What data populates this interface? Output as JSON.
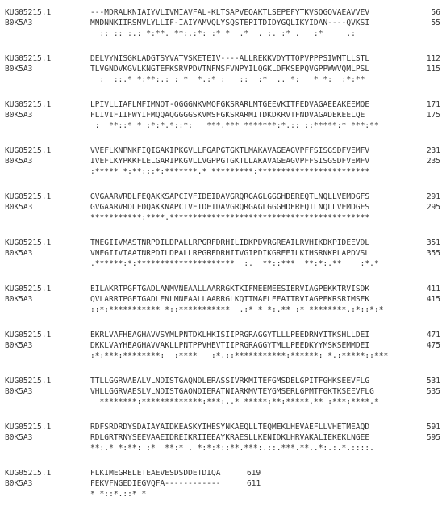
{
  "alignment": {
    "blocks": [
      {
        "rows": [
          {
            "name": "KUG05215.1",
            "seq": "---MDRALKNIAIYVLIVMIAVFAL-KLTSAPVEQAKTLSEPEFYTKVSQGQVAEAVVEV",
            "pos": "56"
          },
          {
            "name": "B0K5A3",
            "seq": "MNDNNKIIRSMVLYLLIF-IAIYAMVQLYSQSTEPITDIDYGQLIKYIDAN----QVKSI",
            "pos": "55"
          }
        ],
        "cons": "  :: :: :.: *:**. **:.:*: :* *  .*  . :. :* .   :*     .:  "
      },
      {
        "rows": [
          {
            "name": "KUG05215.1",
            "seq": "DELVYNISGKLADGTSYVATVSKETEIV----ALLREKKVDYTTQPVPPPSIWMTLLSTL",
            "pos": "112"
          },
          {
            "name": "B0K5A3",
            "seq": "TLVGNDVKGVLKNGTEFKSRVPDVTNFMSFVNPYILQGKLDFKSEPQVGPPWWVQMLPSL",
            "pos": "115"
          }
        ],
        "cons": "  :  ::.* *:**:.: : *  *.:* :   ::  :*  .. *:   * *:  :*:**"
      },
      {
        "rows": [
          {
            "name": "KUG05215.1",
            "seq": "LPIVLLIAFLMFIMNQT-QGGGNKVMQFGKSRARLMTGEEVKITFEDVAGAEEAKEEMQE",
            "pos": "171"
          },
          {
            "name": "B0K5A3",
            "seq": "FLIVIFIIFWYIFMQQAQGGGGSKVMSFGKSRARMITDKDKRVTFNDVAGADEKEELQE",
            "pos": "175"
          }
        ],
        "cons": " :  **::* * :*:*.*::*:   ***.*** *******:*.:: ::*****:* ***:**"
      },
      {
        "rows": [
          {
            "name": "KUG05215.1",
            "seq": "VVEFLKNPNKFIQIGAKIPKGVLLFGAPGTGKTLMAKAVAGEAGVPFFSISGSDFVEMFV",
            "pos": "231"
          },
          {
            "name": "B0K5A3",
            "seq": "IVEFLKYPKKFLELGARIPKGVLLVGPPGTGKTLLAKAVAGEAGVPFFSISGSDFVEMFV",
            "pos": "235"
          }
        ],
        "cons": ":***** *:**:::*:*******.* *********:************************"
      },
      {
        "rows": [
          {
            "name": "KUG05215.1",
            "seq": "GVGAARVRDLFEQAKKSAPCIVFIDEIDAVGRQRGAGLGGGHDEREQTLNQLLVEMDGFS",
            "pos": "291"
          },
          {
            "name": "B0K5A3",
            "seq": "GVGAARVRDLFDQAKKNAPCIVFIDEIDAVGRQRGAGLGGGHDEREQTLNQLLVEMDGFS",
            "pos": "295"
          }
        ],
        "cons": "***********:****.*******************************************"
      },
      {
        "rows": [
          {
            "name": "KUG05215.1",
            "seq": "TNEGIIVMASTNRPDILDPALLRPGRFDRHILIDKPDVRGREAILRVHIKDKPIDEEVDL",
            "pos": "351"
          },
          {
            "name": "B0K5A3",
            "seq": "VNEGIIVIAATNRPDILDPALLRPGRFDRHITVGIPDIKGREEILKIHSRNKPLAPDVSL",
            "pos": "355"
          }
        ],
        "cons": ".******:*:*********************  :.  **::***  **:*:.**    :*.*"
      },
      {
        "rows": [
          {
            "name": "KUG05215.1",
            "seq": "EILAKRTPGFTGADLANMVNEAALLAARRGKTKIFMEEMEESIERVIAGPEKKTRVISDK",
            "pos": "411"
          },
          {
            "name": "B0K5A3",
            "seq": "QVLARRTPGFTGADLENLMNEAALLAARRGLKQITMAELEEAITRVIAGPEKRSRIMSEK",
            "pos": "415"
          }
        ],
        "cons": "::*:*********** *::***********  .:* * *:.** :* ********.:*::*:*"
      },
      {
        "rows": [
          {
            "name": "KUG05215.1",
            "seq": "EKRLVAFHEAGHAVVSYMLPNTDKLHKISIIPRGRAGGYTLLLPEEDRNYITKSHLLDEI",
            "pos": "471"
          },
          {
            "name": "B0K5A3",
            "seq": "DKKLVAYHEAGHAVVAKLLPNTPPVHEVTIIPRGRAGGYTMLLPEEDKYYMSKSEMMDEI",
            "pos": "475"
          }
        ],
        "cons": ":*:***:********:  :****   :*.::***********:******: *.:*****::***"
      },
      {
        "rows": [
          {
            "name": "KUG05215.1",
            "seq": "TTLLGGRVAEALVLNDISTGAQNDLERASSIVRKMITEFGMSDELGPITFGHKSEEVFLG",
            "pos": "531"
          },
          {
            "name": "B0K5A3",
            "seq": "VHLLGGRVAESLVLNDISTGAQNDIERATNIARKMVTEYGMSERLGPMTFGKTKSEEVFLG",
            "pos": "535"
          }
        ],
        "cons": "  ********:*************:***:..* *****:**:*****.** :***:****.*"
      },
      {
        "rows": [
          {
            "name": "KUG05215.1",
            "seq": "RDFSRDRDYSDAIAYAIDKEASKYIHESYNKAEQLLTEQMEKLHEVAEFLLVHETMEAQD",
            "pos": "591"
          },
          {
            "name": "B0K5A3",
            "seq": "RDLGRTRNYSEEVAAEIDREIKRIIEEAYKRAESLLKENIDKLHRVAKALIEKEKLNGEE",
            "pos": "595"
          }
        ],
        "cons": "**:.* *:**: :*  **:* . *:*:*::**.***:.::.***.**..*:.:.*.::::."
      },
      {
        "rows": [
          {
            "name": "KUG05215.1",
            "seq": "FLKIMEGRELETEAEVESDSDDETDIQA",
            "pos": "619"
          },
          {
            "name": "B0K5A3",
            "seq": "FEKVFNGEDIEGVQFA------------",
            "pos": "611"
          }
        ],
        "cons": "* *::*.::* *"
      }
    ]
  }
}
